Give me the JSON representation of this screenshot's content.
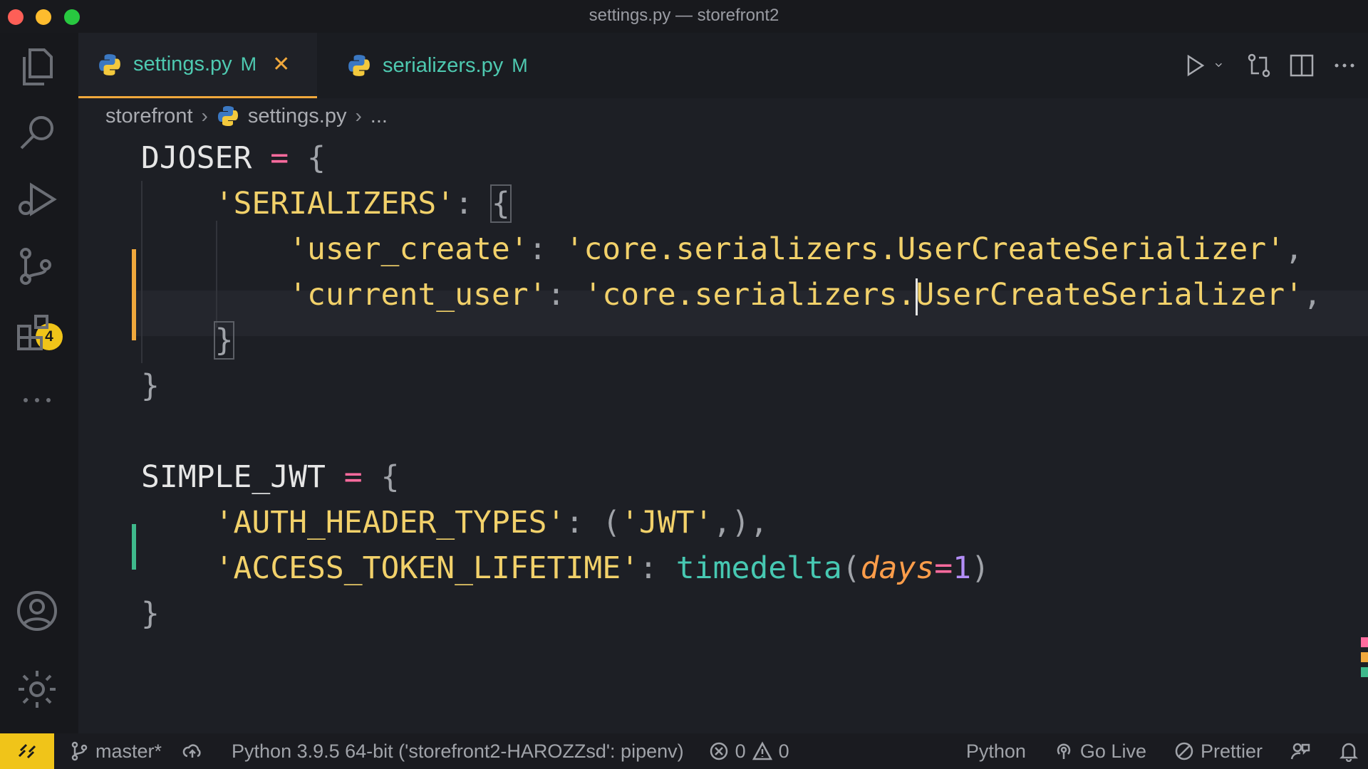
{
  "window": {
    "title": "settings.py — storefront2"
  },
  "activity_bar": {
    "source_control_badge": "4"
  },
  "tabs": [
    {
      "name": "settings.py",
      "status": "M",
      "active": true
    },
    {
      "name": "serializers.py",
      "status": "M",
      "active": false
    }
  ],
  "breadcrumb": {
    "folder": "storefront",
    "file": "settings.py",
    "more": "..."
  },
  "code": {
    "l1": {
      "ident": "DJOSER",
      "op": "=",
      "brace": "{"
    },
    "l2": {
      "key": "'SERIALIZERS'",
      "colon": ":",
      "brace": "{"
    },
    "l3": {
      "key": "'user_create'",
      "colon": ":",
      "value": "'core.serializers.UserCreateSerializer'",
      "comma": ","
    },
    "l4": {
      "key": "'current_user'",
      "colon": ":",
      "value_a": "'core.serializers.",
      "value_b": "UserCreateSerializer'",
      "comma": ","
    },
    "l5": {
      "brace": "}"
    },
    "l6": {
      "brace": "}"
    },
    "l7": {
      "ident": "SIMPLE_JWT",
      "op": "=",
      "brace": "{"
    },
    "l8": {
      "key": "'AUTH_HEADER_TYPES'",
      "colon": ":",
      "open": "(",
      "value": "'JWT'",
      "close": ",),"
    },
    "l9": {
      "key": "'ACCESS_TOKEN_LIFETIME'",
      "colon": ":",
      "func": "timedelta",
      "open": "(",
      "kw": "days",
      "eq": "=",
      "num": "1",
      "close": ")"
    },
    "l10": {
      "brace": "}"
    }
  },
  "statusbar": {
    "branch": "master*",
    "interpreter": "Python 3.9.5 64-bit ('storefront2-HAROZZsd': pipenv)",
    "errors": "0",
    "warnings": "0",
    "language": "Python",
    "go_live": "Go Live",
    "prettier": "Prettier"
  },
  "colors": {
    "accent": "#f0c419",
    "modified": "#f0a83c",
    "added": "#3fb98c"
  }
}
